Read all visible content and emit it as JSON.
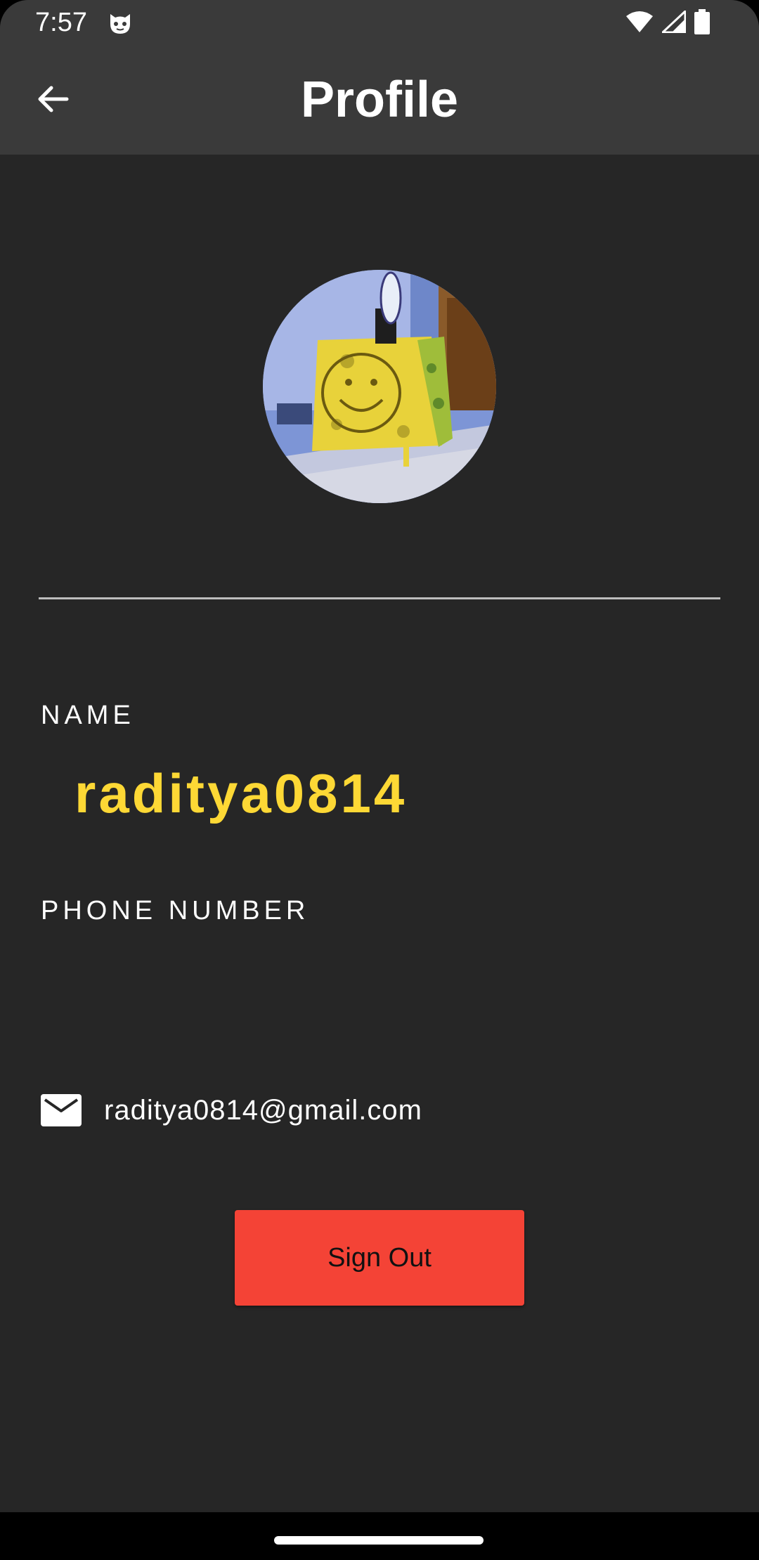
{
  "status_bar": {
    "time": "7:57",
    "notification_icon": "cat-face-icon",
    "icons": [
      "wifi-icon",
      "cell-signal-icon",
      "battery-icon"
    ]
  },
  "app_bar": {
    "title": "Profile",
    "back_icon": "arrow-left-icon"
  },
  "profile": {
    "avatar": "spongebob-avatar",
    "name_label": "NAME",
    "name_value": "raditya0814",
    "phone_label": "PHONE NUMBER",
    "phone_value": "",
    "email_icon": "mail-icon",
    "email_value": "raditya0814@gmail.com"
  },
  "actions": {
    "sign_out_label": "Sign Out"
  },
  "colors": {
    "background": "#262626",
    "app_bar": "#3a3a3a",
    "name_accent": "#fdd835",
    "sign_out": "#f44336"
  }
}
